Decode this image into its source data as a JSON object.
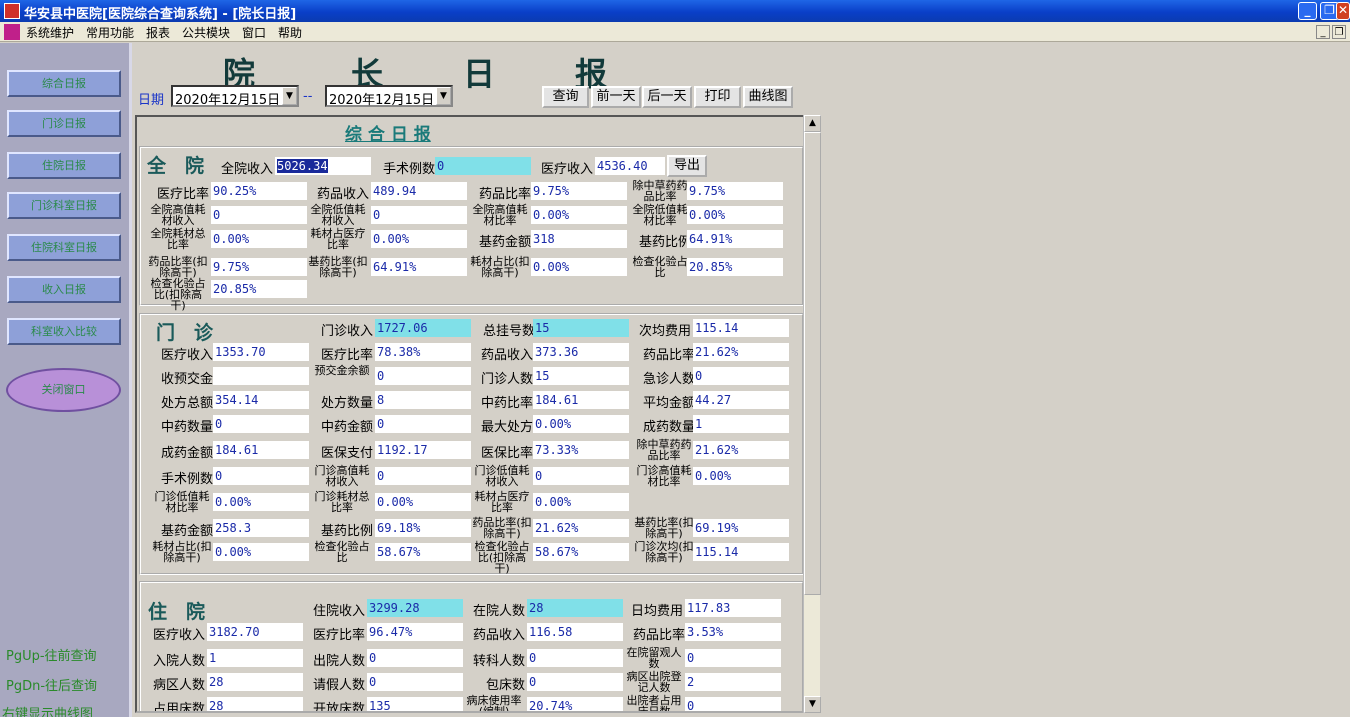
{
  "window": {
    "title": "华安县中医院[医院综合查询系统] - [院长日报]",
    "min": "_",
    "restore": "❐",
    "close": "✕"
  },
  "menu": [
    "系统维护",
    "常用功能",
    "报表",
    "公共模块",
    "窗口",
    "帮助"
  ],
  "sidebar": {
    "buttons": [
      "综合日报",
      "门诊日报",
      "住院日报",
      "门诊科室日报",
      "住院科室日报",
      "收入日报",
      "科室收入比较"
    ],
    "oval": "关闭窗口",
    "hints": [
      "PgUp-往前查询",
      "PgDn-往后查询",
      "右键显示曲线图"
    ]
  },
  "header": {
    "title_chars": [
      "院",
      "长",
      "日",
      "报"
    ],
    "date_label": "日期",
    "date_from": "2020年12月15日",
    "sep": "--",
    "date_to": "2020年12月15日",
    "buttons": {
      "query": "查询",
      "prev": "前一天",
      "next": "后一天",
      "print": "打印",
      "curve": "曲线图"
    }
  },
  "report": {
    "heading": "综 合 日 报"
  },
  "whole": {
    "title": "全　院",
    "export": "导出",
    "row0": [
      {
        "k": "全院收入",
        "v": "5026.34"
      },
      {
        "k": "手术例数",
        "v": "0"
      },
      {
        "k": "医疗收入",
        "v": "4536.40"
      }
    ],
    "rows": [
      [
        {
          "k": "医疗比率",
          "v": "90.25%"
        },
        {
          "k": "药品收入",
          "v": "489.94"
        },
        {
          "k": "药品比率",
          "v": "9.75%"
        },
        {
          "k": "除中草药药品比率",
          "v": "9.75%"
        }
      ],
      [
        {
          "k": "全院高值耗材收入",
          "v": "0"
        },
        {
          "k": "全院低值耗材收入",
          "v": "0"
        },
        {
          "k": "全院高值耗材比率",
          "v": "0.00%"
        },
        {
          "k": "全院低值耗材比率",
          "v": "0.00%"
        }
      ],
      [
        {
          "k": "全院耗材总比率",
          "v": "0.00%"
        },
        {
          "k": "耗材占医疗比率",
          "v": "0.00%"
        },
        {
          "k": "基药金额",
          "v": "318"
        },
        {
          "k": "基药比例",
          "v": "64.91%"
        }
      ],
      [
        {
          "k": "药品比率(扣除高干)",
          "v": "9.75%"
        },
        {
          "k": "基药比率(扣除高干)",
          "v": "64.91%"
        },
        {
          "k": "耗材占比(扣除高干)",
          "v": "0.00%"
        },
        {
          "k": "检查化验占比",
          "v": "20.85%"
        }
      ],
      [
        {
          "k": "检查化验占比(扣除高干)",
          "v": "20.85%"
        }
      ]
    ]
  },
  "outpatient": {
    "title": "门　诊",
    "row0": [
      {
        "k": "门诊收入",
        "v": "1727.06"
      },
      {
        "k": "总挂号数",
        "v": "15"
      },
      {
        "k": "次均费用",
        "v": "115.14"
      }
    ],
    "rows": [
      [
        {
          "k": "医疗收入",
          "v": "1353.70"
        },
        {
          "k": "医疗比率",
          "v": "78.38%"
        },
        {
          "k": "药品收入",
          "v": "373.36"
        },
        {
          "k": "药品比率",
          "v": "21.62%"
        }
      ],
      [
        {
          "k": "收预交金",
          "v": ""
        },
        {
          "k": "预交金余额",
          "v": "0"
        },
        {
          "k": "门诊人数",
          "v": "15"
        },
        {
          "k": "急诊人数",
          "v": "0"
        }
      ],
      [
        {
          "k": "处方总额",
          "v": "354.14"
        },
        {
          "k": "处方数量",
          "v": "8"
        },
        {
          "k": "中药比率",
          "v": "184.61"
        },
        {
          "k": "平均金额",
          "v": "44.27"
        }
      ],
      [
        {
          "k": "中药数量",
          "v": "0"
        },
        {
          "k": "中药金额",
          "v": "0"
        },
        {
          "k": "最大处方",
          "v": "0.00%"
        },
        {
          "k": "成药数量",
          "v": "1"
        }
      ],
      [
        {
          "k": "成药金额",
          "v": "184.61"
        },
        {
          "k": "医保支付",
          "v": "1192.17"
        },
        {
          "k": "医保比率",
          "v": "73.33%"
        },
        {
          "k": "除中草药药品比率",
          "v": "21.62%"
        }
      ],
      [
        {
          "k": "手术例数",
          "v": "0"
        },
        {
          "k": "门诊高值耗材收入",
          "v": "0"
        },
        {
          "k": "门诊低值耗材收入",
          "v": "0"
        },
        {
          "k": "门诊高值耗材比率",
          "v": "0.00%"
        }
      ],
      [
        {
          "k": "门诊低值耗材比率",
          "v": "0.00%"
        },
        {
          "k": "门诊耗材总比率",
          "v": "0.00%"
        },
        {
          "k": "耗材占医疗比率",
          "v": "0.00%"
        }
      ],
      [
        {
          "k": "基药金额",
          "v": "258.3"
        },
        {
          "k": "基药比例",
          "v": "69.18%"
        },
        {
          "k": "药品比率(扣除高干)",
          "v": "21.62%"
        },
        {
          "k": "基药比率(扣除高干)",
          "v": "69.19%"
        }
      ],
      [
        {
          "k": "耗材占比(扣除高干)",
          "v": "0.00%"
        },
        {
          "k": "检查化验占比",
          "v": "58.67%"
        },
        {
          "k": "检查化验占比(扣除高干)",
          "v": "58.67%"
        },
        {
          "k": "门诊次均(扣除高干)",
          "v": "115.14"
        }
      ]
    ]
  },
  "inpatient": {
    "title": "住　院",
    "row0": [
      {
        "k": "住院收入",
        "v": "3299.28"
      },
      {
        "k": "在院人数",
        "v": "28"
      },
      {
        "k": "日均费用",
        "v": "117.83"
      }
    ],
    "rows": [
      [
        {
          "k": "医疗收入",
          "v": "3182.70"
        },
        {
          "k": "医疗比率",
          "v": "96.47%"
        },
        {
          "k": "药品收入",
          "v": "116.58"
        },
        {
          "k": "药品比率",
          "v": "3.53%"
        }
      ],
      [
        {
          "k": "入院人数",
          "v": "1"
        },
        {
          "k": "出院人数",
          "v": "0"
        },
        {
          "k": "转科人数",
          "v": "0"
        },
        {
          "k": "在院留观人数",
          "v": "0"
        }
      ],
      [
        {
          "k": "病区人数",
          "v": "28"
        },
        {
          "k": "请假人数",
          "v": "0"
        },
        {
          "k": "包床数",
          "v": "0"
        },
        {
          "k": "病区出院登记人数",
          "v": "2"
        }
      ],
      [
        {
          "k": "占用床数",
          "v": "28"
        },
        {
          "k": "开放床数",
          "v": "135"
        },
        {
          "k": "病床使用率(编制)",
          "v": "20.74%"
        },
        {
          "k": "出院者占用床日数",
          "v": "0"
        }
      ]
    ]
  }
}
